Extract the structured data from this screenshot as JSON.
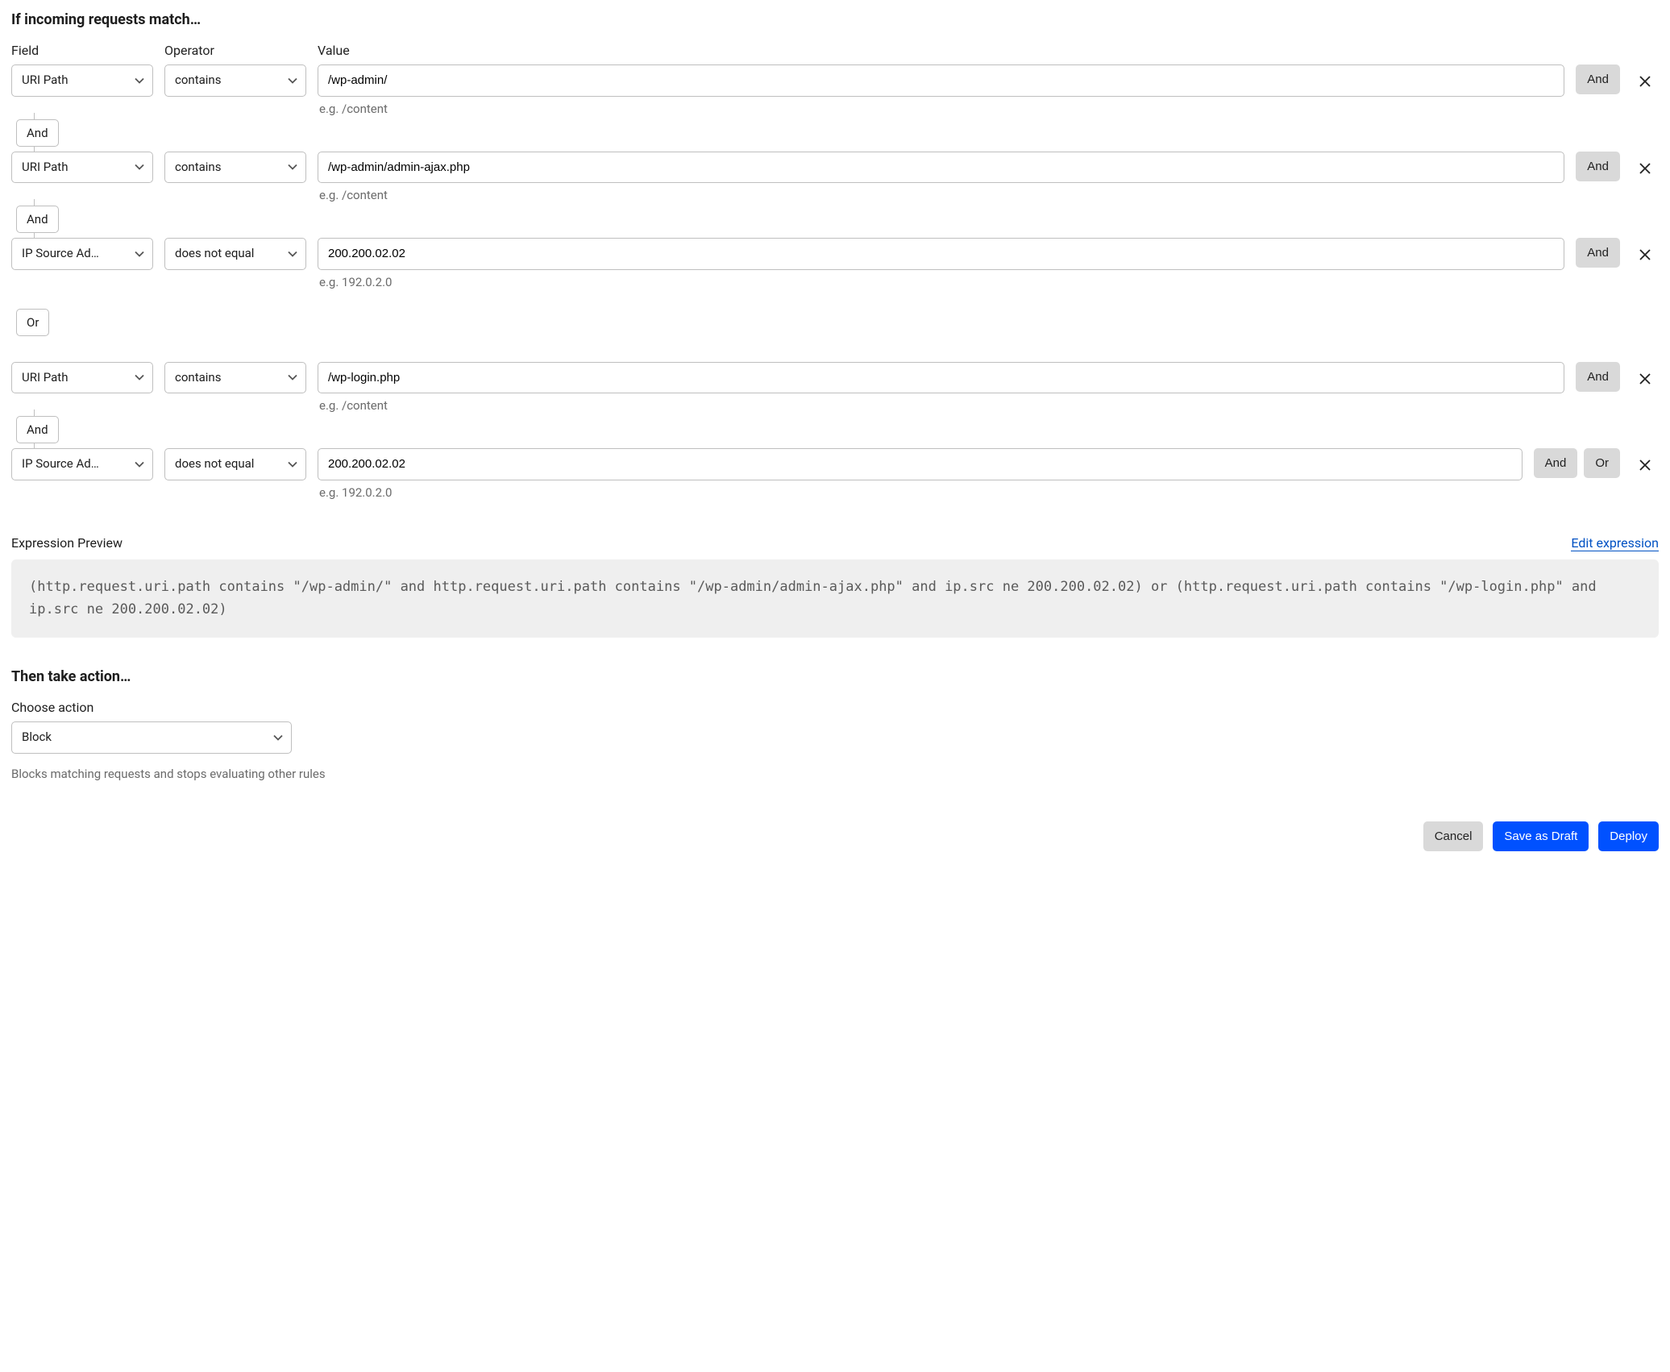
{
  "sectionTitle": "If incoming requests match…",
  "headers": {
    "field": "Field",
    "operator": "Operator",
    "value": "Value"
  },
  "rows": [
    {
      "field": "URI Path",
      "operator": "contains",
      "value": "/wp-admin/",
      "hint": "e.g. /content",
      "trailing": [
        "And"
      ],
      "connectorAfter": "And"
    },
    {
      "field": "URI Path",
      "operator": "contains",
      "value": "/wp-admin/admin-ajax.php",
      "hint": "e.g. /content",
      "trailing": [
        "And"
      ],
      "connectorAfter": "And"
    },
    {
      "field": "IP Source Ad…",
      "operator": "does not equal",
      "value": "200.200.02.02",
      "hint": "e.g. 192.0.2.0",
      "trailing": [
        "And"
      ],
      "connectorAfter": "Or",
      "orStyle": true
    },
    {
      "field": "URI Path",
      "operator": "contains",
      "value": "/wp-login.php",
      "hint": "e.g. /content",
      "trailing": [
        "And"
      ],
      "connectorAfter": "And"
    },
    {
      "field": "IP Source Ad…",
      "operator": "does not equal",
      "value": "200.200.02.02",
      "hint": "e.g. 192.0.2.0",
      "trailing": [
        "And",
        "Or"
      ]
    }
  ],
  "preview": {
    "label": "Expression Preview",
    "editLabel": "Edit expression",
    "code": "(http.request.uri.path contains \"/wp-admin/\" and http.request.uri.path contains \"/wp-admin/admin-ajax.php\" and ip.src ne 200.200.02.02) or (http.request.uri.path contains \"/wp-login.php\" and ip.src ne 200.200.02.02)"
  },
  "action": {
    "title": "Then take action…",
    "chooseLabel": "Choose action",
    "selected": "Block",
    "hint": "Blocks matching requests and stops evaluating other rules"
  },
  "footer": {
    "cancel": "Cancel",
    "draft": "Save as Draft",
    "deploy": "Deploy"
  }
}
